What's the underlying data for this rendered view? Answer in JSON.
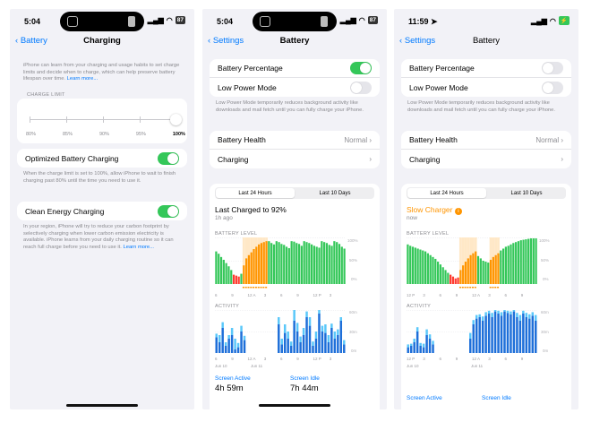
{
  "colors": {
    "green": "#34c759",
    "orange": "#ff9500",
    "blue": "#007aff",
    "red": "#ff3b30",
    "activity_dark": "#1e6fd9",
    "activity_light": "#5ac8fa"
  },
  "p1": {
    "time": "5:04",
    "battery": "87",
    "back": "Battery",
    "title": "Charging",
    "intro": "iPhone can learn from your charging and usage habits to set charge limits and decide when to charge, which can help preserve battery lifespan over time.",
    "learn_more": "Learn more...",
    "charge_limit_caption": "CHARGE LIMIT",
    "limit_labels": [
      "80%",
      "85%",
      "90%",
      "95%",
      "100%"
    ],
    "optimized_label": "Optimized Battery Charging",
    "optimized_on": true,
    "optimized_note": "When the charge limit is set to 100%, allow iPhone to wait to finish charging past 80% until the time you need to use it.",
    "clean_label": "Clean Energy Charging",
    "clean_on": true,
    "clean_note": "In your region, iPhone will try to reduce your carbon footprint by selectively charging when lower carbon emission electricity is available. iPhone learns from your daily charging routine so it can reach full charge before you need to use it.",
    "clean_learn": "Learn more..."
  },
  "p2": {
    "time": "5:04",
    "battery": "87",
    "back": "Settings",
    "title": "Battery",
    "pct_label": "Battery Percentage",
    "pct_on": true,
    "lpm_label": "Low Power Mode",
    "lpm_on": false,
    "lpm_note": "Low Power Mode temporarily reduces background activity like downloads and mail fetch until you can fully charge your iPhone.",
    "health_label": "Battery Health",
    "health_value": "Normal",
    "charging_label": "Charging",
    "tabs": [
      "Last 24 Hours",
      "Last 10 Days"
    ],
    "last_charged": "Last Charged to 92%",
    "ago": "1h ago",
    "battery_level_caption": "BATTERY LEVEL",
    "activity_caption": "ACTIVITY",
    "y_level": [
      "100%",
      "50%",
      "0%"
    ],
    "y_activity": [
      "60m",
      "30m",
      "0m"
    ],
    "x_labels": [
      "6",
      "9",
      "12 A",
      "3",
      "6",
      "9",
      "12 P",
      "3"
    ],
    "date_labels": [
      "Jun 10",
      "Jun 11"
    ],
    "screen_active_label": "Screen Active",
    "screen_active_value": "4h 59m",
    "screen_idle_label": "Screen Idle",
    "screen_idle_value": "7h 44m"
  },
  "p3": {
    "time": "11:59",
    "back": "Settings",
    "title": "Battery",
    "pct_label": "Battery Percentage",
    "pct_on": false,
    "lpm_label": "Low Power Mode",
    "lpm_on": false,
    "lpm_note": "Low Power Mode temporarily reduces background activity like downloads and mail fetch until you can fully charge your iPhone.",
    "health_label": "Battery Health",
    "health_value": "Normal",
    "charging_label": "Charging",
    "tabs": [
      "Last 24 Hours",
      "Last 10 Days"
    ],
    "status_title": "Slow Charger",
    "status_sub": "now",
    "battery_level_caption": "BATTERY LEVEL",
    "activity_caption": "ACTIVITY",
    "y_level": [
      "100%",
      "50%",
      "0%"
    ],
    "y_activity": [
      "60m",
      "30m",
      "0m"
    ],
    "x_labels": [
      "12 P",
      "3",
      "6",
      "9",
      "12 A",
      "3",
      "6",
      "9"
    ],
    "date_labels": [
      "Jun 10",
      "Jun 11"
    ],
    "screen_active_label": "Screen Active",
    "screen_idle_label": "Screen Idle"
  },
  "chart_data": [
    {
      "type": "bar",
      "title": "BATTERY LEVEL",
      "panel": "p2",
      "ylim": [
        0,
        100
      ],
      "values": [
        70,
        65,
        58,
        52,
        45,
        38,
        30,
        20,
        18,
        16,
        22,
        40,
        55,
        62,
        68,
        75,
        80,
        85,
        88,
        90,
        92,
        92,
        88,
        85,
        92,
        90,
        86,
        84,
        80,
        77,
        92,
        91,
        88,
        86,
        82,
        92,
        90,
        88,
        85,
        82,
        80,
        78,
        92,
        90,
        88,
        84,
        82,
        92,
        90,
        86,
        80,
        76
      ],
      "charging": [
        0,
        0,
        0,
        0,
        0,
        0,
        0,
        0,
        0,
        0,
        0,
        1,
        1,
        1,
        1,
        1,
        1,
        1,
        1,
        1,
        1,
        0,
        0,
        0,
        0,
        0,
        0,
        0,
        0,
        0,
        0,
        0,
        0,
        0,
        0,
        0,
        0,
        0,
        0,
        0,
        0,
        0,
        0,
        0,
        0,
        0,
        0,
        0,
        0,
        0,
        0,
        0
      ]
    },
    {
      "type": "bar",
      "title": "ACTIVITY",
      "panel": "p2",
      "ylim": [
        0,
        60
      ],
      "series": [
        {
          "values": [
            22,
            15,
            35,
            10,
            20,
            25,
            5,
            8,
            30,
            18,
            0,
            0,
            0,
            0,
            0,
            0,
            0,
            0,
            0,
            0,
            40,
            12,
            28,
            20,
            10,
            45,
            30,
            15,
            25,
            50,
            38,
            10,
            20,
            55,
            30,
            28,
            15,
            35,
            20,
            25,
            45,
            12
          ]
        },
        {
          "values": [
            5,
            10,
            8,
            5,
            5,
            10,
            15,
            6,
            8,
            6,
            0,
            0,
            0,
            0,
            0,
            0,
            0,
            0,
            0,
            0,
            10,
            8,
            12,
            10,
            6,
            15,
            12,
            8,
            10,
            8,
            12,
            6,
            10,
            5,
            8,
            12,
            10,
            6,
            10,
            8,
            5,
            6
          ]
        }
      ]
    },
    {
      "type": "bar",
      "title": "BATTERY LEVEL",
      "panel": "p3",
      "ylim": [
        0,
        100
      ],
      "values": [
        85,
        82,
        80,
        78,
        76,
        74,
        72,
        70,
        66,
        62,
        58,
        54,
        48,
        42,
        36,
        30,
        24,
        20,
        16,
        12,
        14,
        30,
        40,
        48,
        55,
        62,
        66,
        70,
        60,
        55,
        50,
        48,
        46,
        52,
        58,
        62,
        66,
        72,
        76,
        80,
        82,
        85,
        88,
        90,
        92,
        94,
        95,
        96,
        97,
        98,
        98,
        98
      ],
      "charging": [
        0,
        0,
        0,
        0,
        0,
        0,
        0,
        0,
        0,
        0,
        0,
        0,
        0,
        0,
        0,
        0,
        0,
        0,
        0,
        0,
        0,
        1,
        1,
        1,
        1,
        1,
        1,
        1,
        0,
        0,
        0,
        0,
        0,
        1,
        1,
        1,
        1,
        0,
        0,
        0,
        0,
        0,
        0,
        0,
        0,
        0,
        0,
        0,
        0,
        0,
        0,
        0
      ]
    },
    {
      "type": "bar",
      "title": "ACTIVITY",
      "panel": "p3",
      "ylim": [
        0,
        60
      ],
      "series": [
        {
          "values": [
            8,
            10,
            15,
            30,
            10,
            8,
            25,
            20,
            12,
            0,
            0,
            0,
            0,
            0,
            0,
            0,
            0,
            0,
            0,
            0,
            20,
            40,
            48,
            50,
            45,
            52,
            55,
            50,
            58,
            55,
            52,
            58,
            56,
            54,
            58,
            50,
            45,
            55,
            50,
            48,
            52,
            45
          ]
        },
        {
          "values": [
            4,
            3,
            5,
            6,
            4,
            5,
            8,
            6,
            5,
            0,
            0,
            0,
            0,
            0,
            0,
            0,
            0,
            0,
            0,
            0,
            8,
            6,
            5,
            4,
            6,
            5,
            4,
            6,
            2,
            4,
            5,
            2,
            3,
            4,
            2,
            6,
            8,
            4,
            6,
            6,
            5,
            8
          ]
        }
      ]
    }
  ]
}
